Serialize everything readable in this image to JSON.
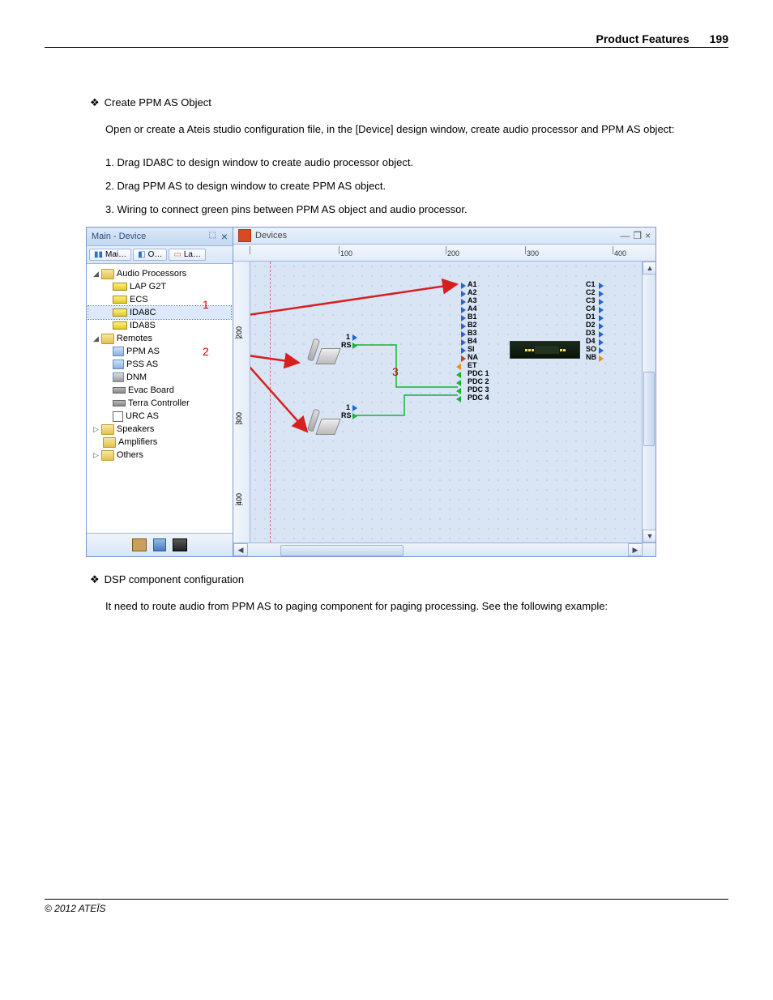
{
  "page": {
    "header_title": "Product Features",
    "number": "199",
    "footer": "© 2012 ATEÏS"
  },
  "section1": {
    "title": "Create PPM AS Object",
    "intro": "Open or create a Ateis studio configuration file, in the [Device] design window, create audio processor and PPM AS object:",
    "steps": [
      "1. Drag IDA8C to design window to create audio processor object.",
      "2. Drag PPM AS to design window to create PPM AS object.",
      "3. Wiring to connect green pins between PPM AS object and audio processor."
    ]
  },
  "section2": {
    "title": "DSP component configuration",
    "intro": "It need to route audio from PPM AS to paging component for paging processing. See the following example:"
  },
  "ui": {
    "left_panel_title": "Main - Device",
    "tabs": [
      "Mai…",
      "O…",
      "La…"
    ],
    "tree": {
      "audio_processors": {
        "label": "Audio Processors",
        "items": [
          "LAP G2T",
          "ECS",
          "IDA8C",
          "IDA8S"
        ]
      },
      "remotes": {
        "label": "Remotes",
        "items": [
          "PPM AS",
          "PSS AS",
          "DNM",
          "Evac Board",
          "Terra Controller",
          "URC AS"
        ]
      },
      "speakers": "Speakers",
      "amplifiers": "Amplifiers",
      "others": "Others"
    },
    "canvas_title": "Devices",
    "ruler_h": [
      "100",
      "200",
      "300",
      "400"
    ],
    "ruler_v": [
      "200",
      "300",
      "400"
    ],
    "rs_labels": {
      "one": "1",
      "rs": "RS"
    },
    "left_pins": [
      "A1",
      "A2",
      "A3",
      "A4",
      "B1",
      "B2",
      "B3",
      "B4",
      "SI",
      "NA",
      "ET",
      "PDC 1",
      "PDC 2",
      "PDC 3",
      "PDC 4"
    ],
    "right_pins": [
      "C1",
      "C2",
      "C3",
      "C4",
      "D1",
      "D2",
      "D3",
      "D4",
      "SO",
      "NB"
    ],
    "step_nums": {
      "one": "1",
      "two": "2",
      "three": "3"
    }
  }
}
